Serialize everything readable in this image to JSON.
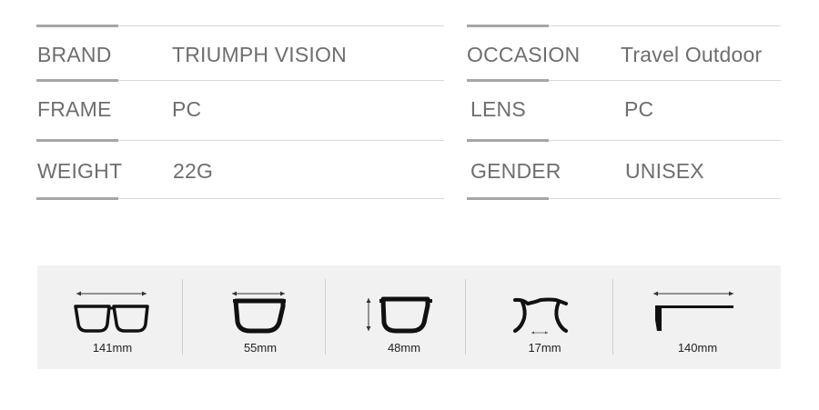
{
  "specs": {
    "rows": [
      {
        "left_label": "BRAND",
        "left_value": "TRIUMPH VISION",
        "right_label": "OCCASION",
        "right_value": "Travel Outdoor"
      },
      {
        "left_label": "FRAME",
        "left_value": "PC",
        "right_label": "LENS",
        "right_value": "PC"
      },
      {
        "left_label": "WEIGHT",
        "left_value": "22G",
        "right_label": "GENDER",
        "right_value": "UNISEX"
      }
    ]
  },
  "dimensions": {
    "items": [
      {
        "icon": "frame-width-icon",
        "value": "141mm"
      },
      {
        "icon": "lens-width-icon",
        "value": "55mm"
      },
      {
        "icon": "lens-height-icon",
        "value": "48mm"
      },
      {
        "icon": "bridge-width-icon",
        "value": "17mm"
      },
      {
        "icon": "temple-length-icon",
        "value": "140mm"
      }
    ]
  },
  "colors": {
    "text": "#6e6e6e",
    "rule_thick": "#a6a6a6",
    "rule_thin": "#d9d9d9",
    "panel": "#f1f1f1",
    "frame": "#111111"
  }
}
